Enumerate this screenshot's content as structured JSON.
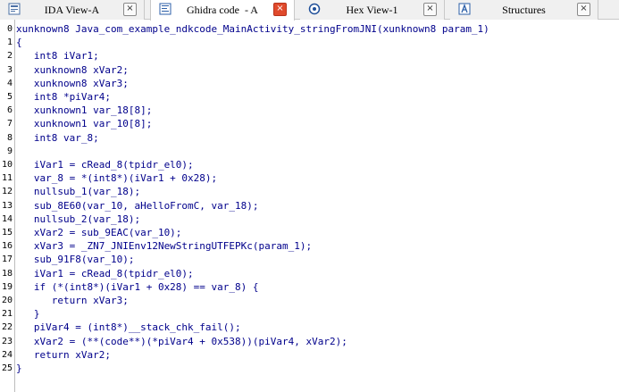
{
  "tabs": [
    {
      "label": "IDA View-A",
      "icon": "ida-view-icon",
      "close": "×",
      "active": false
    },
    {
      "label": "Ghidra code  - A",
      "icon": "ghidra-code-icon",
      "close": "×",
      "active": true
    },
    {
      "label": "Hex View-1",
      "icon": "hex-view-icon",
      "close": "×",
      "active": false
    },
    {
      "label": "Structures",
      "icon": "structures-icon",
      "close": "×",
      "active": false
    }
  ],
  "code_lines": [
    {
      "n": "0",
      "text": "xunknown8 Java_com_example_ndkcode_MainActivity_stringFromJNI(xunknown8 param_1)"
    },
    {
      "n": "1",
      "text": "{"
    },
    {
      "n": "2",
      "text": "   int8 iVar1;"
    },
    {
      "n": "3",
      "text": "   xunknown8 xVar2;"
    },
    {
      "n": "4",
      "text": "   xunknown8 xVar3;"
    },
    {
      "n": "5",
      "text": "   int8 *piVar4;"
    },
    {
      "n": "6",
      "text": "   xunknown1 var_18[8];"
    },
    {
      "n": "7",
      "text": "   xunknown1 var_10[8];"
    },
    {
      "n": "8",
      "text": "   int8 var_8;"
    },
    {
      "n": "9",
      "text": ""
    },
    {
      "n": "10",
      "text": "   iVar1 = cRead_8(tpidr_el0);"
    },
    {
      "n": "11",
      "text": "   var_8 = *(int8*)(iVar1 + 0x28);"
    },
    {
      "n": "12",
      "text": "   nullsub_1(var_18);"
    },
    {
      "n": "13",
      "text": "   sub_8E60(var_10, aHelloFromC, var_18);"
    },
    {
      "n": "14",
      "text": "   nullsub_2(var_18);"
    },
    {
      "n": "15",
      "text": "   xVar2 = sub_9EAC(var_10);"
    },
    {
      "n": "16",
      "text": "   xVar3 = _ZN7_JNIEnv12NewStringUTFEPKc(param_1);"
    },
    {
      "n": "17",
      "text": "   sub_91F8(var_10);"
    },
    {
      "n": "18",
      "text": "   iVar1 = cRead_8(tpidr_el0);"
    },
    {
      "n": "19",
      "text": "   if (*(int8*)(iVar1 + 0x28) == var_8) {"
    },
    {
      "n": "20",
      "text": "      return xVar3;"
    },
    {
      "n": "21",
      "text": "   }"
    },
    {
      "n": "22",
      "text": "   piVar4 = (int8*)__stack_chk_fail();"
    },
    {
      "n": "23",
      "text": "   xVar2 = (**(code**)(*piVar4 + 0x538))(piVar4, xVar2);"
    },
    {
      "n": "24",
      "text": "   return xVar2;"
    },
    {
      "n": "25",
      "text": "}"
    }
  ],
  "colors": {
    "code_text": "#00008b",
    "active_close": "#e04a2c"
  }
}
